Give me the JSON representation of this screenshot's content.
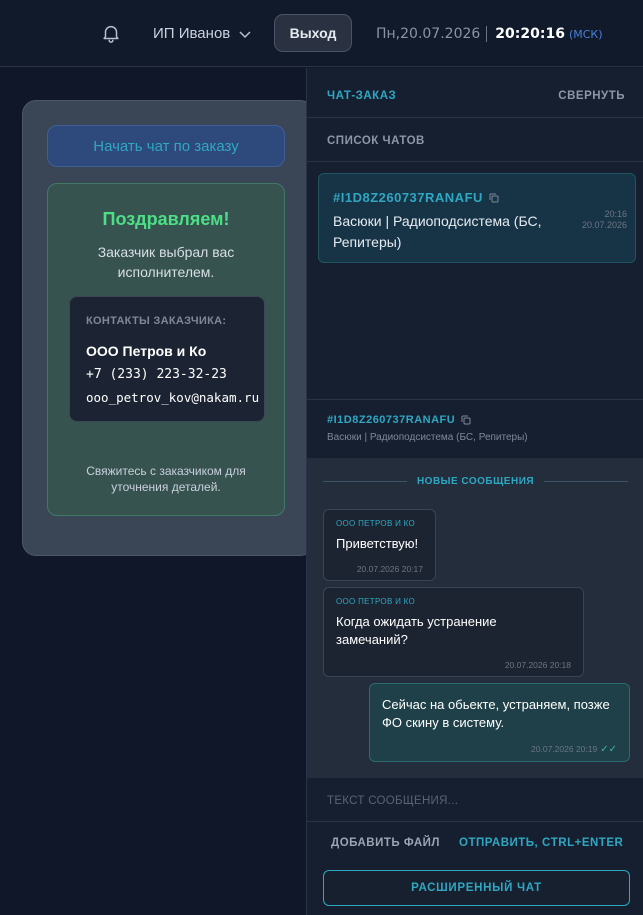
{
  "header": {
    "user_name": "ИП Иванов",
    "logout_label": "Выход",
    "date": "Пн,20.07.2026",
    "time": "20:20:16",
    "timezone": "(МСК)"
  },
  "order_card": {
    "start_chat_label": "Начать чат по заказу",
    "congrats_title": "Поздравляем!",
    "congrats_text": "Заказчик выбрал вас исполнителем.",
    "contacts_label": "КОНТАКТЫ ЗАКАЗЧИКА:",
    "company": "ООО Петров и Ко",
    "phone": "+7 (233) 223-32-23",
    "email": "ooo_petrov_kov@nakam.ru",
    "hint": "Свяжитесь с заказчиком для уточнения деталей."
  },
  "panel": {
    "title": "ЧАТ-ЗАКАЗ",
    "collapse_label": "СВЕРНУТЬ",
    "list_title": "СПИСОК ЧАТОВ",
    "chats": [
      {
        "id": "#I1D8Z260737RANAFU",
        "name": "Васюки | Радиоподсистема (БС, Репитеры)",
        "time": "20:16",
        "date": "20.07.2026"
      }
    ],
    "conversation": {
      "id": "#I1D8Z260737RANAFU",
      "name": "Васюки | Радиоподсистема (БС, Репитеры)",
      "new_messages_label": "НОВЫЕ СООБЩЕНИЯ",
      "messages": [
        {
          "from": "ООО ПЕТРОВ И КО",
          "text": "Приветствую!",
          "time": "20.07.2026 20:17"
        },
        {
          "from": "ООО ПЕТРОВ И КО",
          "text": "Когда ожидать устранение замечаний?",
          "time": "20.07.2026 20:18"
        },
        {
          "from": "",
          "text": "Сейчас на обьекте, устраняем, позже ФО скину в систему.",
          "time": "20.07.2026 20:19",
          "check": "✓✓"
        }
      ]
    },
    "compose_placeholder": "ТЕКСТ СООБЩЕНИЯ...",
    "add_file_label": "ДОБАВИТЬ ФАЙЛ",
    "send_label": "ОТПРАВИТЬ, CTRL+ENTER",
    "extended_chat_label": "РАСШИРЕННЫЙ ЧАТ"
  },
  "colors": {
    "accent": "#2fa7c2",
    "success": "#4ddf86",
    "background": "#0f1728"
  }
}
